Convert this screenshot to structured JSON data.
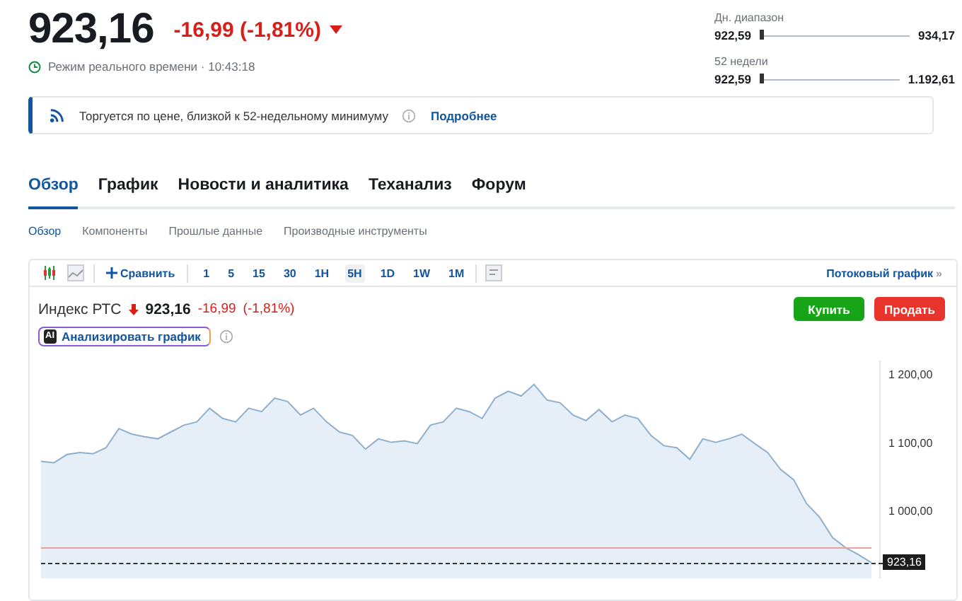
{
  "quote": {
    "price": "923,16",
    "change": "-16,99 (-1,81%)",
    "down": true,
    "status": "Режим реального времени · 10:43:18"
  },
  "ranges": [
    {
      "label": "Дн. диапазон",
      "low": "922,59",
      "high": "934,17",
      "level": 0.0
    },
    {
      "label": "52 недели",
      "low": "922,59",
      "high": "1.192,61",
      "level": 0.0
    }
  ],
  "banner": {
    "text": "Торгуется по цене, близкой к 52-недельному минимуму",
    "link": "Подробнее"
  },
  "tabs": [
    {
      "label": "Обзор",
      "selected": true
    },
    {
      "label": "График",
      "selected": false
    },
    {
      "label": "Новости и аналитика",
      "selected": false
    },
    {
      "label": "Теханализ",
      "selected": false
    },
    {
      "label": "Форум",
      "selected": false
    }
  ],
  "subtabs": [
    {
      "label": "Обзор",
      "selected": true
    },
    {
      "label": "Компоненты",
      "selected": false
    },
    {
      "label": "Прошлые данные",
      "selected": false
    },
    {
      "label": "Производные инструменты",
      "selected": false
    }
  ],
  "toolbar": {
    "compare": "Сравнить",
    "intervals": [
      {
        "label": "1",
        "selected": false
      },
      {
        "label": "5",
        "selected": false
      },
      {
        "label": "15",
        "selected": false
      },
      {
        "label": "30",
        "selected": false
      },
      {
        "label": "1H",
        "selected": false
      },
      {
        "label": "5H",
        "selected": true
      },
      {
        "label": "1D",
        "selected": false
      },
      {
        "label": "1W",
        "selected": false
      },
      {
        "label": "1M",
        "selected": false
      }
    ],
    "stream": "Потоковый график",
    "stream_mark": "»"
  },
  "instrument": {
    "name": "Индекс РТС",
    "price": "923,16",
    "change": "-16,99",
    "percent": "(-1,81%)",
    "buy": "Купить",
    "sell": "Продать",
    "analyze": "Анализировать график",
    "ai_badge": "AI"
  },
  "chart_data": {
    "type": "area",
    "categories": [
      null,
      null,
      null,
      null,
      null,
      null,
      null,
      null,
      null,
      null,
      null,
      null,
      null,
      null,
      null,
      null,
      null,
      null,
      null,
      null,
      null,
      null,
      null,
      null,
      null,
      null,
      null,
      null,
      null,
      null,
      null,
      null,
      null,
      null,
      null,
      null,
      null,
      null,
      null,
      null,
      null,
      null,
      null,
      null,
      null,
      null,
      null,
      null,
      null,
      null,
      null,
      null,
      null,
      null,
      null,
      null,
      null,
      null,
      null,
      null,
      null,
      null,
      null,
      null,
      null
    ],
    "ylim": [
      900,
      1220
    ],
    "yticks": [
      {
        "value": 1000,
        "label": "1 000,00"
      },
      {
        "value": 1100,
        "label": "1 100,00"
      },
      {
        "value": 1200,
        "label": "1 200,00"
      }
    ],
    "series": [
      {
        "color": "#8fb0cc",
        "values": [
          1072,
          1070,
          1082,
          1085,
          1083,
          1092,
          1120,
          1112,
          1108,
          1105,
          1115,
          1125,
          1130,
          1150,
          1135,
          1130,
          1150,
          1145,
          1165,
          1160,
          1140,
          1150,
          1130,
          1115,
          1110,
          1090,
          1105,
          1100,
          1102,
          1098,
          1125,
          1130,
          1150,
          1145,
          1135,
          1165,
          1175,
          1168,
          1185,
          1162,
          1158,
          1140,
          1132,
          1148,
          1130,
          1140,
          1135,
          1110,
          1095,
          1092,
          1075,
          1105,
          1100,
          1105,
          1112,
          1098,
          1085,
          1060,
          1045,
          1010,
          990,
          960,
          945,
          935,
          923
        ]
      }
    ]
  },
  "price_tag": "923,16"
}
